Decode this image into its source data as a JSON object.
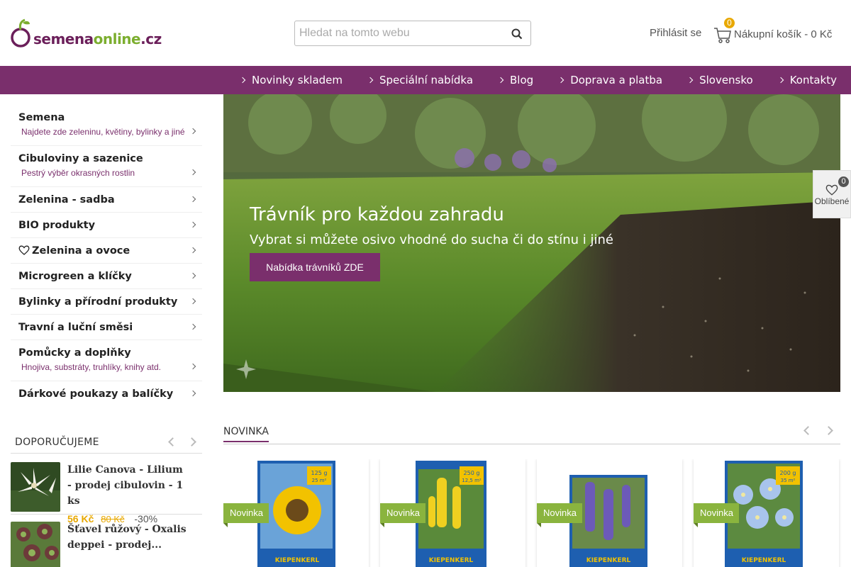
{
  "header": {
    "logo": {
      "brand_main": "semena",
      "brand_accent": "online",
      "brand_tld": ".cz"
    },
    "search": {
      "placeholder": "Hledat na tomto webu",
      "value": ""
    },
    "login_label": "Přihlásit se",
    "cart": {
      "count": "0",
      "label": "Nákupní košík - 0 Kč"
    }
  },
  "nav": {
    "items": [
      {
        "label": "Novinky skladem"
      },
      {
        "label": "Speciální nabídka"
      },
      {
        "label": "Blog"
      },
      {
        "label": "Doprava a platba"
      },
      {
        "label": "Slovensko"
      },
      {
        "label": "Kontakty"
      }
    ]
  },
  "sidebar": {
    "categories": [
      {
        "title": "Semena",
        "subtitle": "Najdete zde zeleninu, květiny, bylinky a jiné"
      },
      {
        "title": "Cibuloviny a sazenice",
        "subtitle": "Pestrý výběr okrasných rostlin"
      },
      {
        "title": "Zelenina - sadba",
        "subtitle": ""
      },
      {
        "title": "BIO produkty",
        "subtitle": ""
      },
      {
        "title": "Zelenina a ovoce",
        "subtitle": "",
        "icon": "heart-icon"
      },
      {
        "title": "Microgreen a klíčky",
        "subtitle": ""
      },
      {
        "title": "Bylinky a přírodní produkty",
        "subtitle": ""
      },
      {
        "title": "Travní a luční směsi",
        "subtitle": ""
      },
      {
        "title": "Pomůcky a doplňky",
        "subtitle": "Hnojiva, substráty, truhlíky, knihy atd."
      },
      {
        "title": "Dárkové poukazy a balíčky",
        "subtitle": ""
      }
    ],
    "recommend": {
      "title": "DOPORUČUJEME",
      "items": [
        {
          "name": "Lilie Canova - Lilium - prodej cibulovin - 1 ks",
          "price": "56 Kč",
          "old_price": "80 Kč",
          "discount": "-30%"
        },
        {
          "name": "Šťavel růžový - Oxalis deppei - prodej...",
          "price": "",
          "old_price": "",
          "discount": ""
        }
      ]
    }
  },
  "hero": {
    "title": "Trávník pro každou zahradu",
    "subtitle": "Vybrat si můžete osivo vhodné do sucha či do stínu i jiné",
    "button_label": "Nabídka trávníků ZDE"
  },
  "favorites": {
    "count": "0",
    "label": "Oblíbené"
  },
  "novinka": {
    "title": "NOVINKA",
    "products": [
      {
        "badge": "Novinka",
        "pack_text": "125 g",
        "pack_sub": "25 m²",
        "brand": "KIEPENKERL"
      },
      {
        "badge": "Novinka",
        "pack_text": "250 g",
        "pack_sub": "12,5 m²",
        "brand": "KIEPENKERL"
      },
      {
        "badge": "Novinka",
        "pack_text": "",
        "pack_sub": "",
        "brand": "KIEPENKERL"
      },
      {
        "badge": "Novinka",
        "pack_text": "200 g",
        "pack_sub": "35 m²",
        "brand": "KIEPENKERL"
      }
    ]
  },
  "colors": {
    "brand_purple": "#7a2f6c",
    "accent_yellow": "#e8a800",
    "badge_green": "#8ab43e"
  }
}
